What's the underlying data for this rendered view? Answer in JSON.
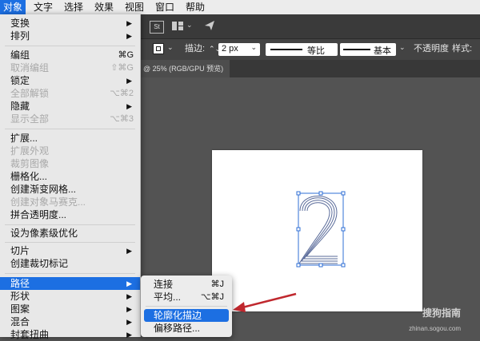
{
  "menubar": {
    "items": [
      "对象",
      "文字",
      "选择",
      "效果",
      "视图",
      "窗口",
      "帮助"
    ]
  },
  "toolbar": {
    "st_label": "St"
  },
  "control_bar": {
    "stroke_label": "描边:",
    "stroke_value": "2 px",
    "profile_label": "等比",
    "brush_label": "基本",
    "opacity_label": "不透明度",
    "style_label": "样式:"
  },
  "document_tab": {
    "title": "@ 25% (RGB/GPU 预览)"
  },
  "object_menu": {
    "items": [
      {
        "label": "变换",
        "shortcut": "",
        "submenu": true,
        "disabled": false
      },
      {
        "label": "排列",
        "shortcut": "",
        "submenu": true,
        "disabled": false
      },
      {
        "label": "编组",
        "shortcut": "⌘G",
        "submenu": false,
        "disabled": false
      },
      {
        "label": "取消编组",
        "shortcut": "⇧⌘G",
        "submenu": false,
        "disabled": true
      },
      {
        "label": "锁定",
        "shortcut": "",
        "submenu": true,
        "disabled": false
      },
      {
        "label": "全部解锁",
        "shortcut": "⌥⌘2",
        "submenu": false,
        "disabled": true
      },
      {
        "label": "隐藏",
        "shortcut": "",
        "submenu": true,
        "disabled": false
      },
      {
        "label": "显示全部",
        "shortcut": "⌥⌘3",
        "submenu": false,
        "disabled": true
      },
      {
        "label": "扩展...",
        "shortcut": "",
        "submenu": false,
        "disabled": false
      },
      {
        "label": "扩展外观",
        "shortcut": "",
        "submenu": false,
        "disabled": true
      },
      {
        "label": "裁剪图像",
        "shortcut": "",
        "submenu": false,
        "disabled": true
      },
      {
        "label": "栅格化...",
        "shortcut": "",
        "submenu": false,
        "disabled": false
      },
      {
        "label": "创建渐变网格...",
        "shortcut": "",
        "submenu": false,
        "disabled": false
      },
      {
        "label": "创建对象马赛克...",
        "shortcut": "",
        "submenu": false,
        "disabled": true
      },
      {
        "label": "拼合透明度...",
        "shortcut": "",
        "submenu": false,
        "disabled": false
      },
      {
        "label": "设为像素级优化",
        "shortcut": "",
        "submenu": false,
        "disabled": false
      },
      {
        "label": "切片",
        "shortcut": "",
        "submenu": true,
        "disabled": false
      },
      {
        "label": "创建裁切标记",
        "shortcut": "",
        "submenu": false,
        "disabled": false
      },
      {
        "label": "路径",
        "shortcut": "",
        "submenu": true,
        "disabled": false,
        "highlighted": true
      },
      {
        "label": "形状",
        "shortcut": "",
        "submenu": true,
        "disabled": false
      },
      {
        "label": "图案",
        "shortcut": "",
        "submenu": true,
        "disabled": false
      },
      {
        "label": "混合",
        "shortcut": "",
        "submenu": true,
        "disabled": false
      },
      {
        "label": "封套扭曲",
        "shortcut": "",
        "submenu": true,
        "disabled": false
      }
    ]
  },
  "path_submenu": {
    "items": [
      {
        "label": "连接",
        "shortcut": "⌘J"
      },
      {
        "label": "平均...",
        "shortcut": "⌥⌘J"
      },
      {
        "label": "轮廓化描边",
        "shortcut": "",
        "highlighted": true
      },
      {
        "label": "偏移路径...",
        "shortcut": ""
      }
    ]
  },
  "watermark": {
    "text": "搜狗指南",
    "url": "zhinan.sogou.com"
  },
  "colors": {
    "accent": "#1c6fe2",
    "arrow": "#c0282e",
    "selection": "#2f6fd6"
  }
}
